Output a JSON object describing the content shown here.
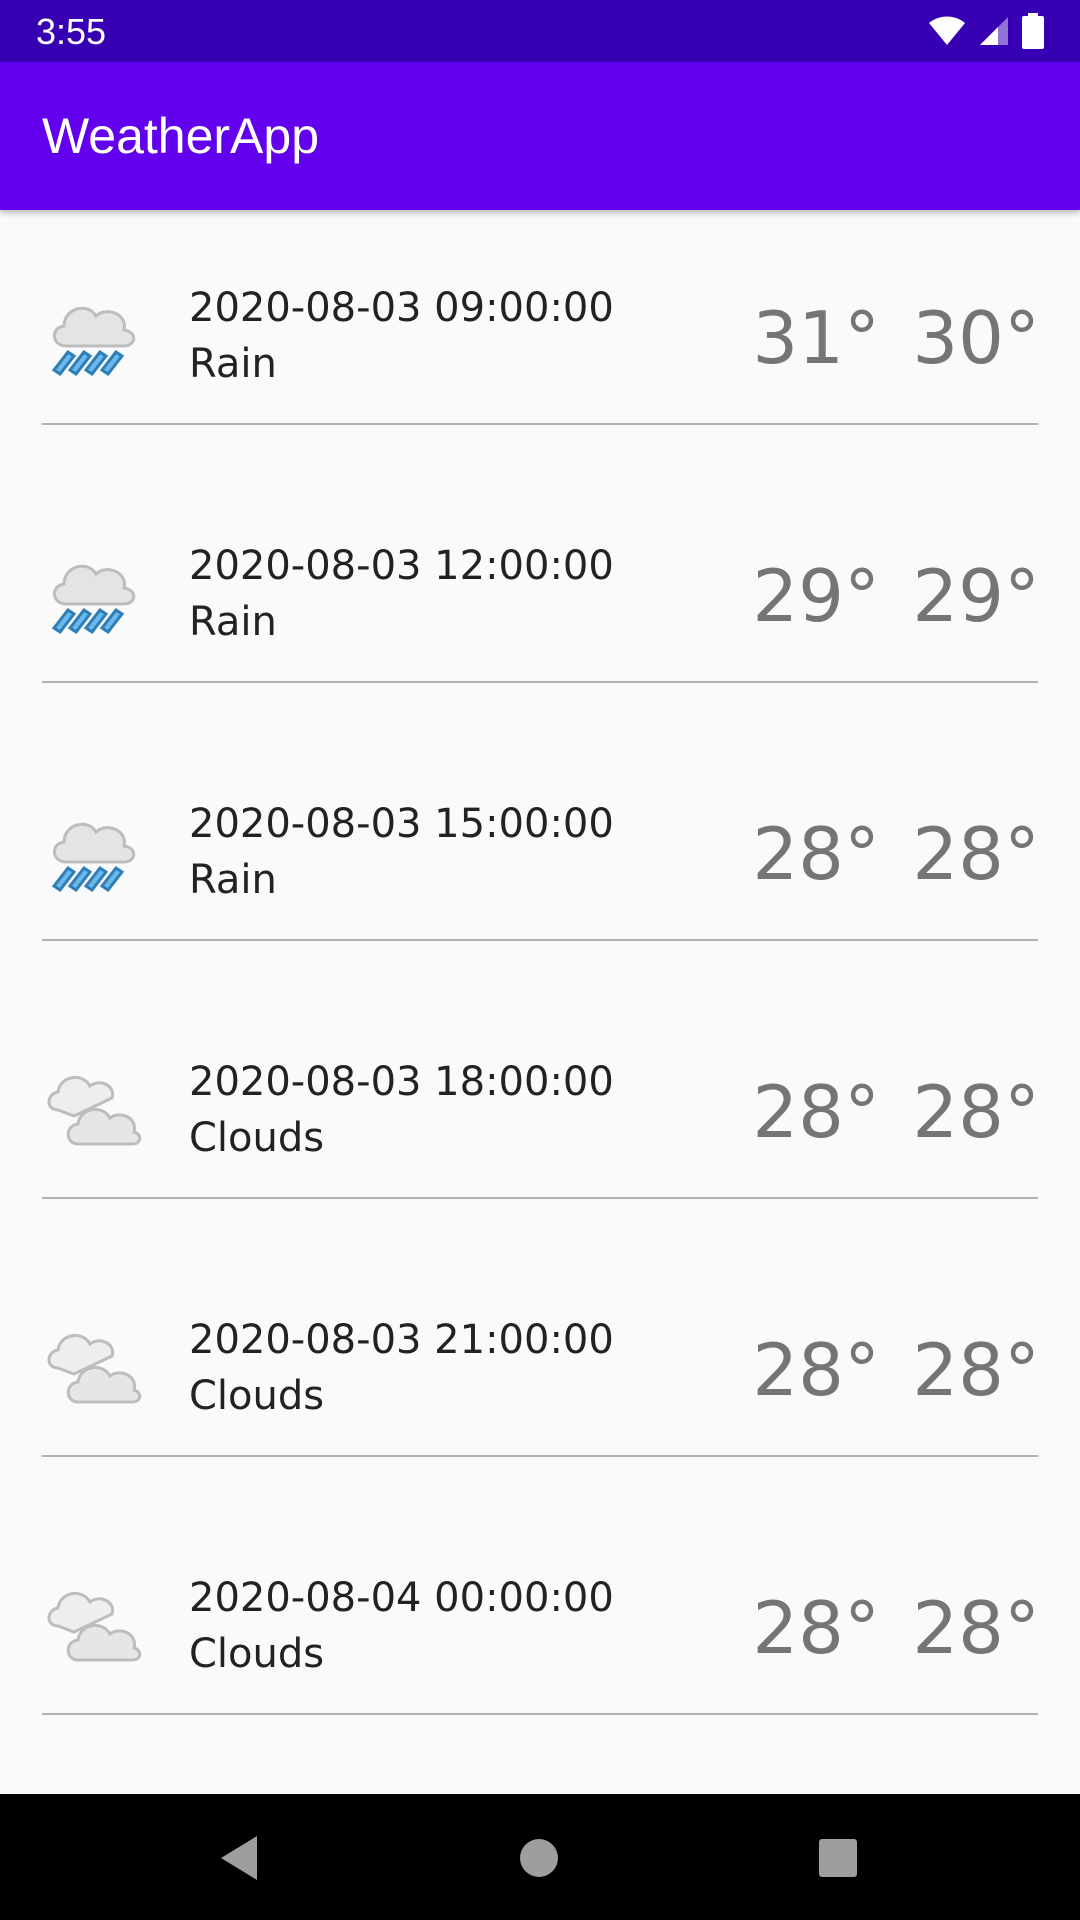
{
  "status_bar": {
    "time": "3:55",
    "icons": [
      "wifi-icon",
      "cellular-signal-icon",
      "battery-icon"
    ]
  },
  "app_bar": {
    "title": "WeatherApp",
    "color": "#6200ee"
  },
  "forecast": [
    {
      "datetime": "2020-08-03 09:00:00",
      "description": "Rain",
      "temp_high": "31°",
      "temp_low": "30°",
      "icon": "rain-cloud-icon"
    },
    {
      "datetime": "2020-08-03 12:00:00",
      "description": "Rain",
      "temp_high": "29°",
      "temp_low": "29°",
      "icon": "rain-cloud-icon"
    },
    {
      "datetime": "2020-08-03 15:00:00",
      "description": "Rain",
      "temp_high": "28°",
      "temp_low": "28°",
      "icon": "rain-cloud-icon"
    },
    {
      "datetime": "2020-08-03 18:00:00",
      "description": "Clouds",
      "temp_high": "28°",
      "temp_low": "28°",
      "icon": "clouds-icon"
    },
    {
      "datetime": "2020-08-03 21:00:00",
      "description": "Clouds",
      "temp_high": "28°",
      "temp_low": "28°",
      "icon": "clouds-icon"
    },
    {
      "datetime": "2020-08-04 00:00:00",
      "description": "Clouds",
      "temp_high": "28°",
      "temp_low": "28°",
      "icon": "clouds-icon"
    }
  ],
  "nav_bar": {
    "buttons": [
      "back-icon",
      "home-icon",
      "recents-icon"
    ]
  }
}
